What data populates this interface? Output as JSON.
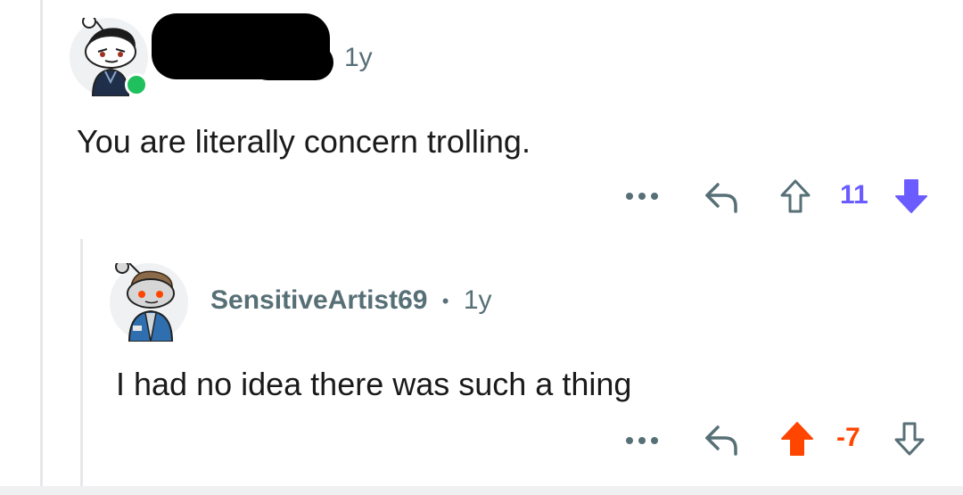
{
  "comment1": {
    "time": "1y",
    "body": "You are literally concern trolling.",
    "more_label": "•••",
    "score": "11",
    "vote_state": "downvoted",
    "score_color": "#6a5cff"
  },
  "comment2": {
    "username": "SensitiveArtist69",
    "separator": "•",
    "time": "1y",
    "body": "I had no idea there was such a thing",
    "more_label": "•••",
    "score": "-7",
    "vote_state": "upvoted",
    "score_color": "#ff4500"
  },
  "icons": {
    "reply": "reply-arrow-icon",
    "upvote": "upvote-arrow-icon",
    "downvote": "downvote-arrow-icon",
    "more": "more-options-icon"
  }
}
